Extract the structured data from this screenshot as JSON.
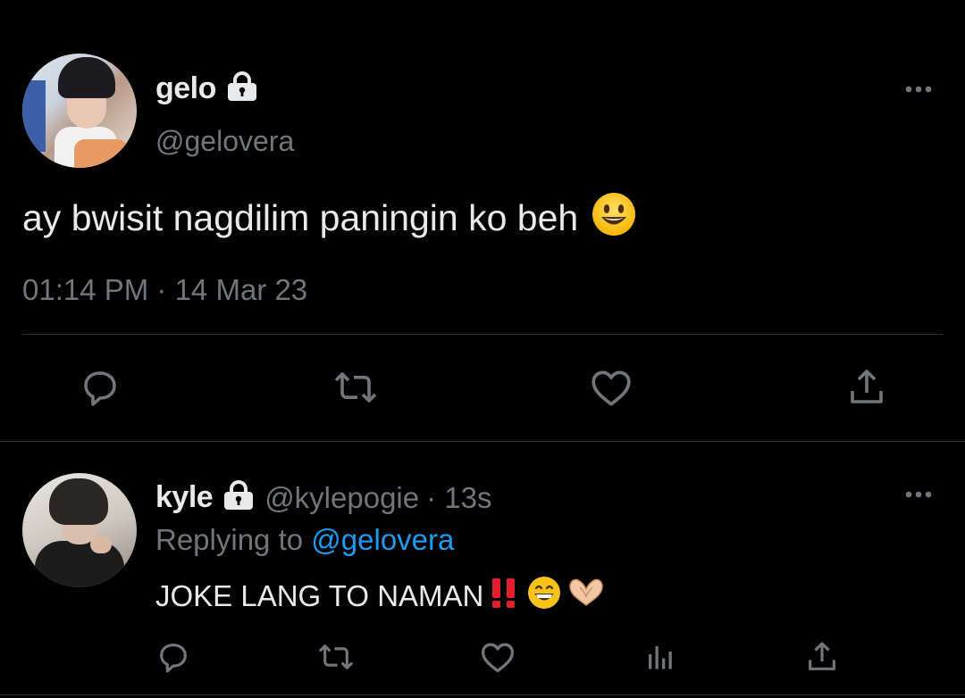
{
  "colors": {
    "background": "#000000",
    "text_primary": "#e7e9ea",
    "text_secondary": "#71767b",
    "link": "#1d9bf0",
    "divider": "#2f3336",
    "icon": "#71767b"
  },
  "main_tweet": {
    "author": {
      "display_name": "gelo",
      "handle": "@gelovera",
      "avatar_icon": "avatar-gelo",
      "protected_icon": "lock-icon"
    },
    "text": "ay bwisit nagdilim paningin ko beh",
    "emoji": "smiling-face-emoji",
    "timestamp": "01:14 PM · 14 Mar 23",
    "actions": [
      "reply-icon",
      "retweet-icon",
      "like-icon",
      "share-icon"
    ],
    "more_icon": "more-icon"
  },
  "reply_tweet": {
    "author": {
      "display_name": "kyle",
      "handle": "@kylepogie",
      "avatar_icon": "avatar-kyle",
      "protected_icon": "lock-icon"
    },
    "time_ago": "· 13s",
    "replying_prefix": "Replying to",
    "replying_handle": "@gelovera",
    "text": "JOKE LANG TO NAMAN",
    "emojis": [
      "double-exclamation-emoji",
      "grinning-face-emoji",
      "heart-hands-emoji"
    ],
    "actions": [
      "reply-icon",
      "retweet-icon",
      "like-icon",
      "views-icon",
      "share-icon"
    ],
    "more_icon": "more-icon"
  }
}
